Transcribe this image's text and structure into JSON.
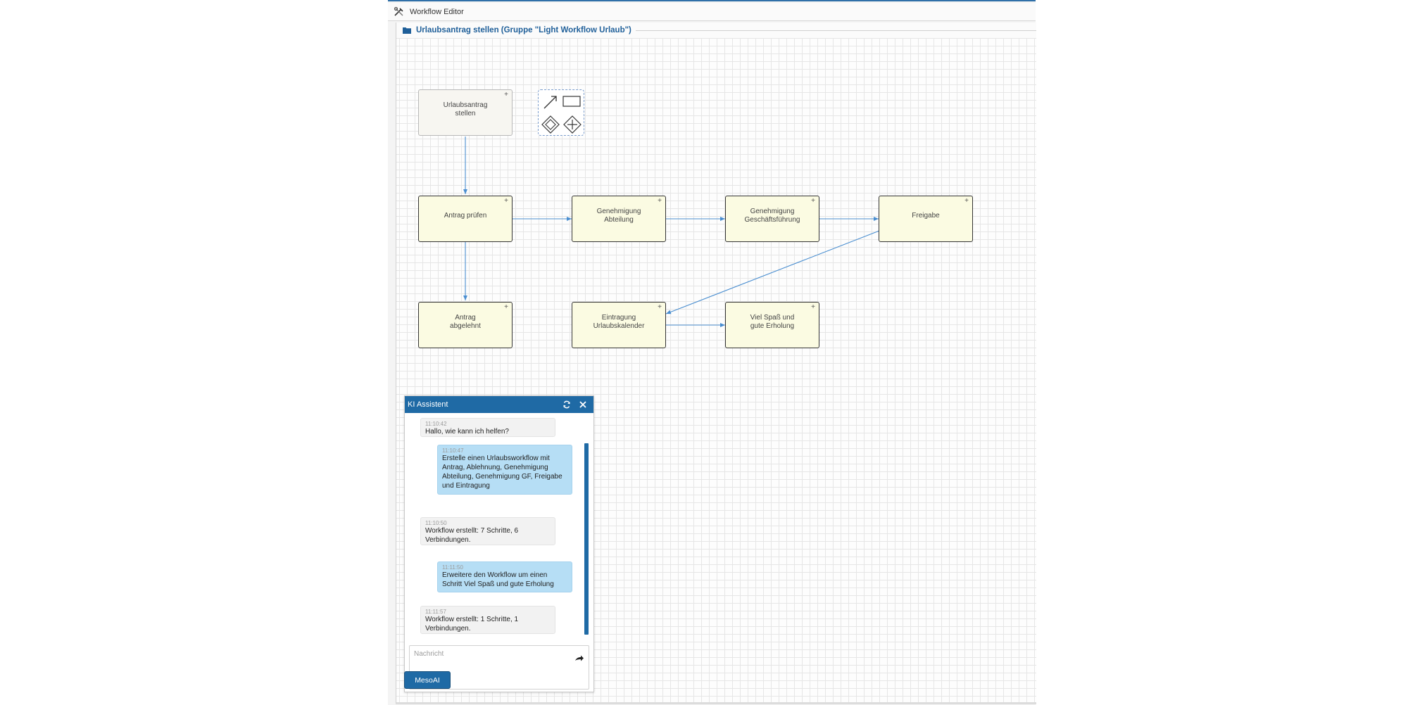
{
  "window": {
    "title": "Workflow Editor",
    "icon": "tools-icon"
  },
  "editor": {
    "title": "Urlaubsantrag stellen (Gruppe \"Light Workflow Urlaub\")",
    "icon": "folder-icon"
  },
  "palette": {
    "tools": [
      "arrow-icon",
      "rectangle-icon",
      "gateway-exclusive-icon",
      "gateway-parallel-icon"
    ]
  },
  "nodes": {
    "start": "Urlaubsantrag\nstellen",
    "pruefen": "Antrag prüfen",
    "abteilung": "Genehmigung\nAbteilung",
    "gf": "Genehmigung\nGeschäftsführung",
    "freigabe": "Freigabe",
    "abgelehnt": "Antrag\nabgelehnt",
    "kalender": "Eintragung\nUrlaubskalender",
    "spass": "Viel Spaß und\ngute Erholung",
    "plus": "+"
  },
  "colors": {
    "accent": "#1f6aa5",
    "connector": "#4a8ed0",
    "node_fill": "#fbfbe2",
    "user_bubble": "#b6def5"
  },
  "chat": {
    "title": "KI Assistent",
    "refresh_icon": "refresh-icon",
    "close_icon": "close-icon",
    "messages": [
      {
        "role": "ai",
        "time": "11:10:42",
        "text": "Hallo, wie kann ich helfen?"
      },
      {
        "role": "user",
        "time": "11:10:47",
        "text": "Erstelle einen Urlaubsworkflow mit Antrag, Ablehnung, Genehmigung Abteilung, Genehmigung GF, Freigabe und Eintragung"
      },
      {
        "role": "ai",
        "time": "11:10:50",
        "text": "Workflow erstellt: 7 Schritte, 6 Verbindungen."
      },
      {
        "role": "user",
        "time": "11:11:50",
        "text": "Erweitere den Workflow um einen Schritt Viel Spaß und gute Erholung"
      },
      {
        "role": "ai",
        "time": "11:11:57",
        "text": "Workflow erstellt: 1 Schritte, 1 Verbindungen."
      }
    ],
    "input_placeholder": "Nachricht",
    "send_icon": "send-icon"
  },
  "meso_button": "MesoAI"
}
